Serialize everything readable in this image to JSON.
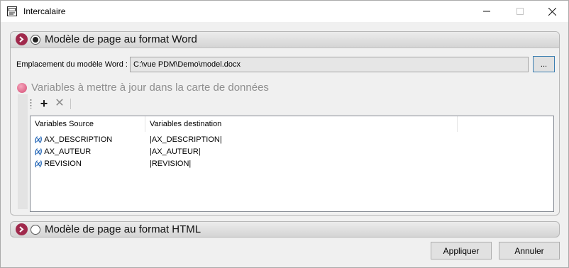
{
  "window": {
    "title": "Intercalaire",
    "icon": "word-page-icon"
  },
  "controls": {
    "minimize": "minimize-icon",
    "maximize": "maximize-icon",
    "close": "close-icon"
  },
  "word_section": {
    "title": "Modèle de page au format Word",
    "selected": true,
    "location_label": "Emplacement du modèle Word :",
    "location_value": "C:\\vue PDM\\Demo\\model.docx",
    "browse_label": "...",
    "variables": {
      "title": "Variables à mettre à jour dans la carte de données",
      "toolbar": {
        "add": "+",
        "delete": "✕"
      },
      "columns": [
        "Variables Source",
        "Variables destination",
        ""
      ],
      "rows": [
        {
          "source": "AX_DESCRIPTION",
          "destination": "|AX_DESCRIPTION|"
        },
        {
          "source": "AX_AUTEUR",
          "destination": "|AX_AUTEUR|"
        },
        {
          "source": "REVISION",
          "destination": "|REVISION|"
        }
      ]
    }
  },
  "html_section": {
    "title": "Modèle de page au format HTML",
    "selected": false
  },
  "buttons": {
    "apply": "Appliquer",
    "cancel": "Annuler"
  },
  "colors": {
    "accent": "#a0294c",
    "variable_icon": "#1f63b5"
  }
}
